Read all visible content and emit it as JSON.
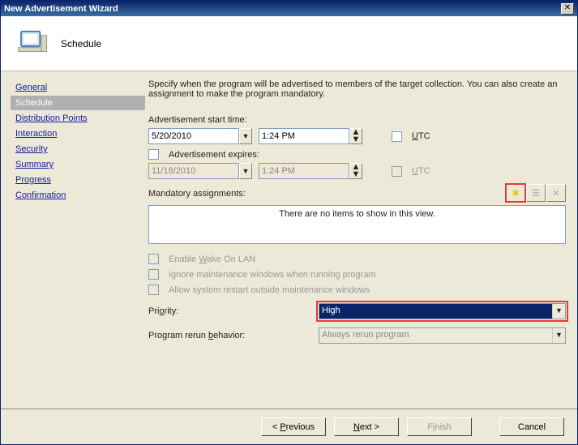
{
  "title": "New Advertisement Wizard",
  "header": {
    "page": "Schedule"
  },
  "nav": {
    "items": [
      "General",
      "Schedule",
      "Distribution Points",
      "Interaction",
      "Security",
      "Summary",
      "Progress",
      "Confirmation"
    ],
    "selected": 1
  },
  "intro": "Specify when the program will be advertised to members of the target collection. You can also create an assignment to make the program mandatory.",
  "start": {
    "label": "Advertisement start time:",
    "date": "5/20/2010",
    "time": "1:24 PM",
    "utc": "UTC"
  },
  "expires": {
    "label": "Advertisement expires:",
    "date": "11/18/2010",
    "time": "1:24 PM",
    "utc": "UTC"
  },
  "mandatory": {
    "label": "Mandatory assignments:",
    "empty": "There are no items to show in this view."
  },
  "opts": {
    "wol": "Enable Wake On LAN",
    "ignore": "Ignore maintenance windows when running program",
    "restart": "Allow system restart outside maintenance windows"
  },
  "priority": {
    "label": "Priority:",
    "value": "High"
  },
  "rerun": {
    "label": "Program rerun behavior:",
    "value": "Always rerun program"
  },
  "buttons": {
    "prev": "< Previous",
    "next": "Next >",
    "finish": "Finish",
    "cancel": "Cancel"
  }
}
